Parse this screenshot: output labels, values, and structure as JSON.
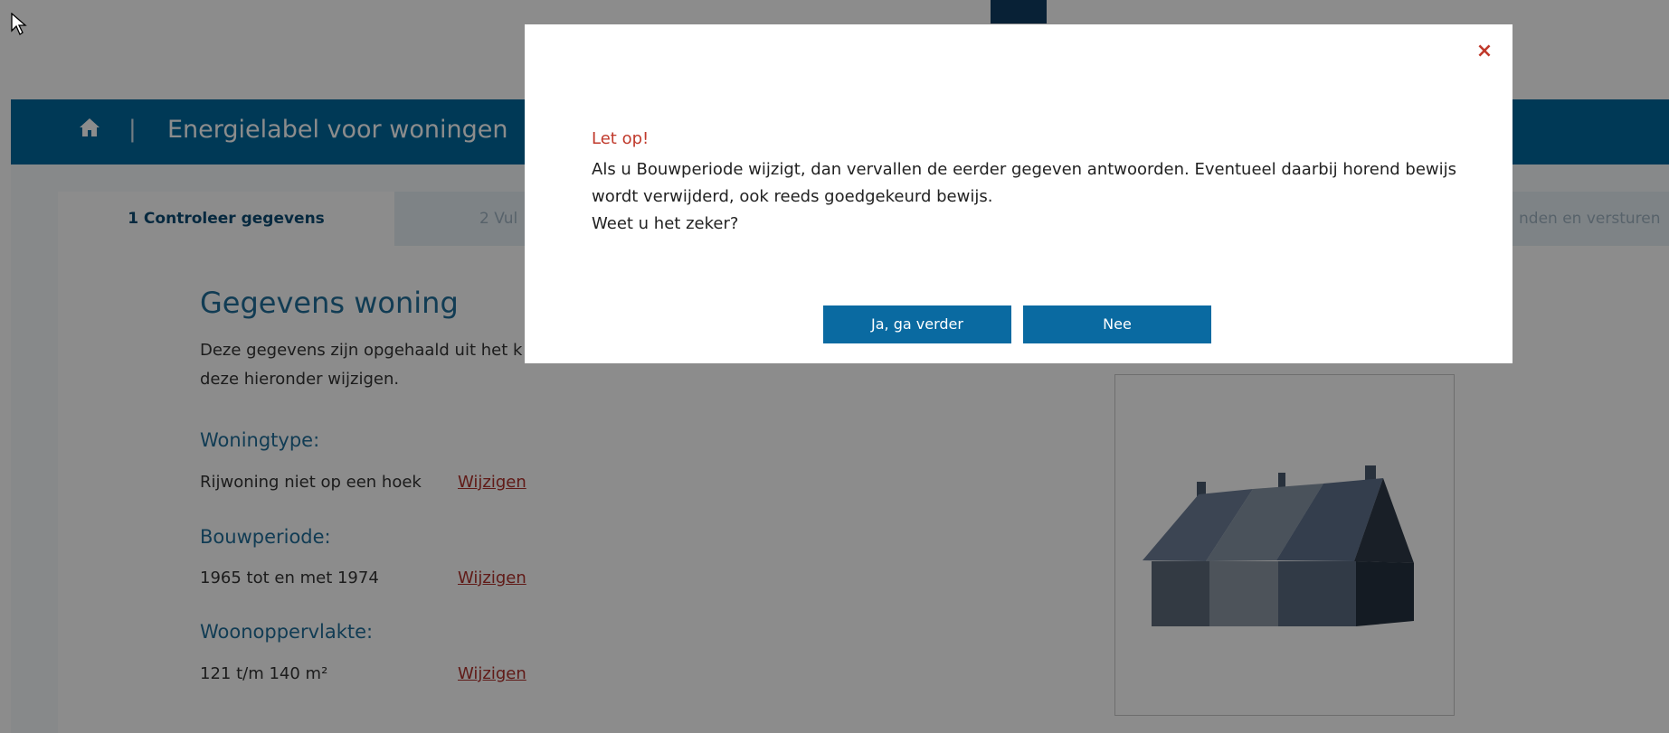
{
  "header": {
    "title": "Energielabel voor woningen",
    "separator": "|"
  },
  "tabs": [
    {
      "label": "1 Controleer gegevens"
    },
    {
      "label": "2 Vul"
    },
    {
      "label": "nden en versturen"
    }
  ],
  "main": {
    "title": "Gegevens woning",
    "intro": "Deze gegevens zijn opgehaald uit het k deze hieronder wijzigen.",
    "sections": [
      {
        "label": "Woningtype:",
        "value": "Rijwoning niet op een hoek",
        "link": "Wijzigen"
      },
      {
        "label": "Bouwperiode:",
        "value": "1965 tot en met 1974",
        "link": "Wijzigen"
      },
      {
        "label": "Woonoppervlakte:",
        "value": "121 t/m 140 m²",
        "link": "Wijzigen"
      }
    ]
  },
  "modal": {
    "close": "×",
    "warning_title": "Let op!",
    "message_line1": "Als u Bouwperiode wijzigt, dan vervallen de eerder gegeven antwoorden. Eventueel daarbij horend bewijs",
    "message_line2": "wordt verwijderd, ook reeds goedgekeurd bewijs.",
    "message_line3": "Weet u het zeker?",
    "yes_label": "Ja, ga verder",
    "no_label": "Nee"
  },
  "icons": {
    "home": "home-icon",
    "close": "close-icon",
    "cursor": "mouse-cursor-icon"
  },
  "colors": {
    "header": "#00689d",
    "button": "#0a6aa1",
    "warning": "#c0392b",
    "link": "#b0302a"
  }
}
